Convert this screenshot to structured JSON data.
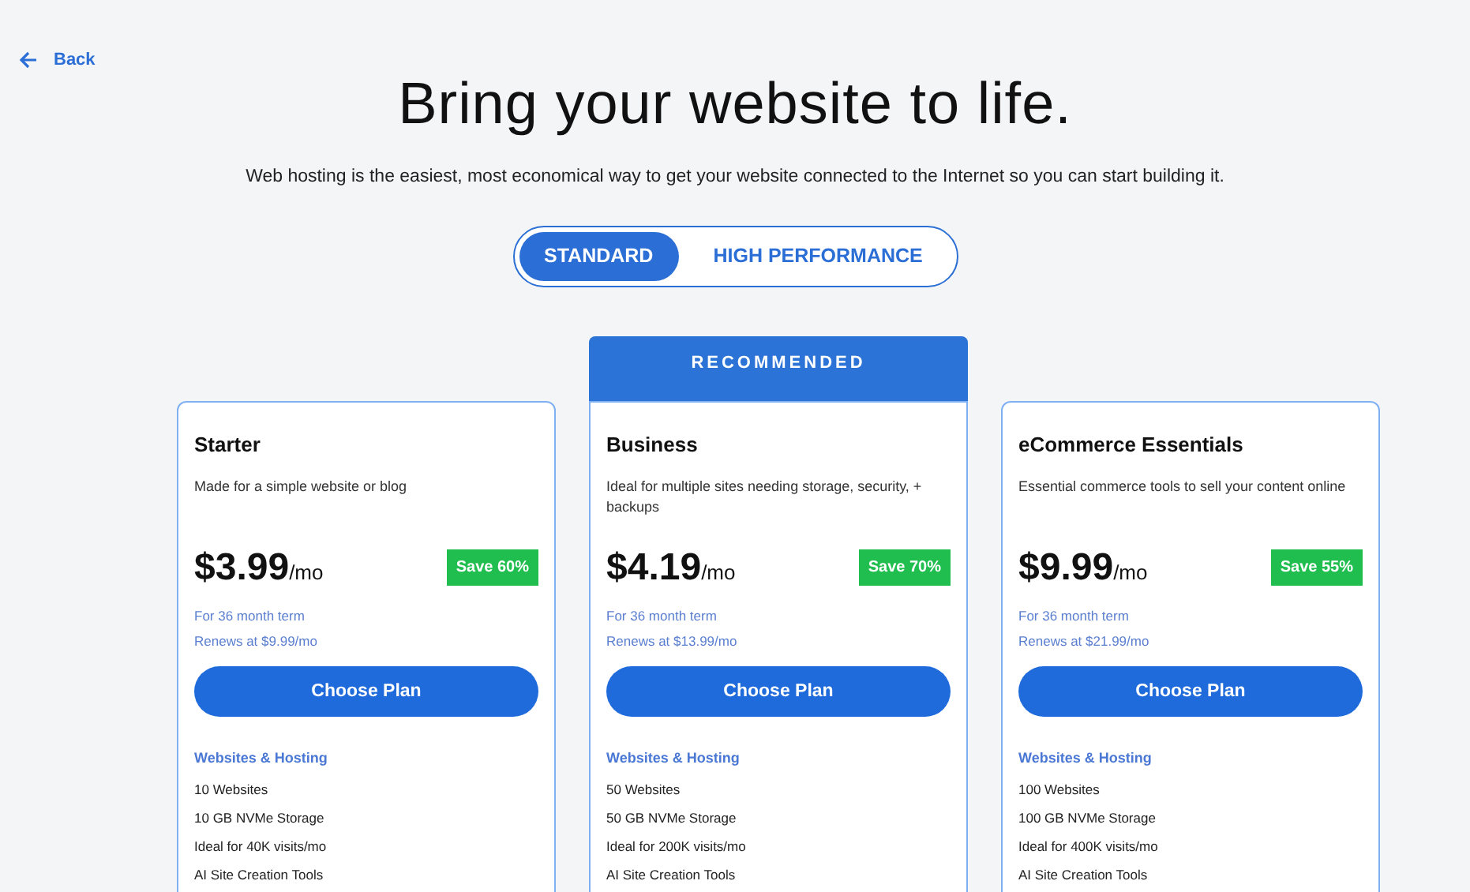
{
  "back_link": "Back",
  "title": "Bring your website to life.",
  "subtitle": "Web hosting is the easiest, most economical way to get your website connected to the Internet so you can start building it.",
  "plan_types": [
    {
      "label": "STANDARD",
      "selected": true
    },
    {
      "label": "HIGH PERFORMANCE",
      "selected": false
    }
  ],
  "plans": [
    {
      "name": "Starter",
      "description": "Made for a simple website or blog",
      "price": "$3.99",
      "unit": "/mo",
      "save": "Save 60%",
      "term": "For 36 month term",
      "renews": "Renews at $9.99/mo",
      "button": "Choose Plan",
      "section": "Websites & Hosting",
      "features": [
        "10 Websites",
        "10 GB NVMe Storage",
        "Ideal for 40K visits/mo",
        "AI Site Creation Tools"
      ]
    },
    {
      "banner": "RECOMMENDED",
      "name": "Business",
      "description": "Ideal for multiple sites needing storage, security, + backups",
      "price": "$4.19",
      "unit": "/mo",
      "save": "Save 70%",
      "term": "For 36 month term",
      "renews": "Renews at $13.99/mo",
      "button": "Choose Plan",
      "section": "Websites & Hosting",
      "features": [
        "50 Websites",
        "50 GB NVMe Storage",
        "Ideal for 200K visits/mo",
        "AI Site Creation Tools"
      ]
    },
    {
      "name": "eCommerce Essentials",
      "description": "Essential commerce tools to sell your content online",
      "price": "$9.99",
      "unit": "/mo",
      "save": "Save 55%",
      "term": "For 36 month term",
      "renews": "Renews at $21.99/mo",
      "button": "Choose Plan",
      "section": "Websites & Hosting",
      "features": [
        "100 Websites",
        "100 GB NVMe Storage",
        "Ideal for 400K visits/mo",
        "AI Site Creation Tools"
      ]
    }
  ]
}
